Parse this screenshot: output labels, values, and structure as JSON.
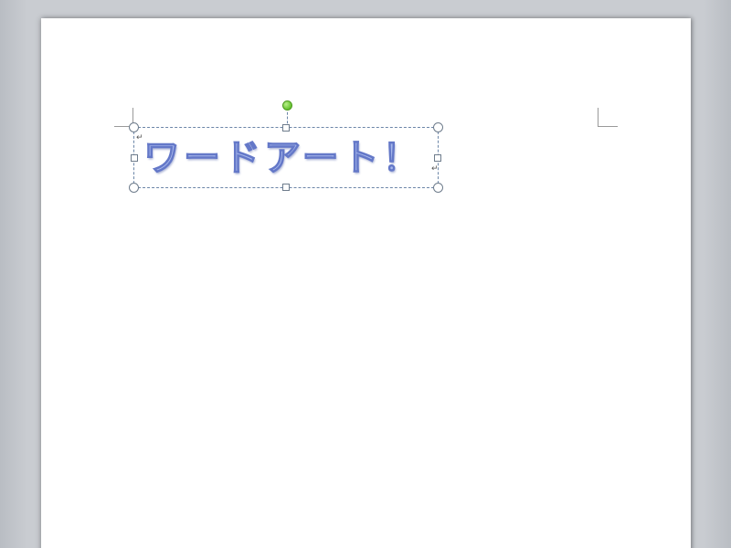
{
  "document": {
    "wordart": {
      "text": "ワードアート！",
      "fill_color": "#a7b8ec",
      "outline_color": "#6478c8",
      "selected": true
    },
    "selection": {
      "rotate_handle_color": "#63c22c",
      "border_color": "#6c86a8",
      "handle_icon": "resize-handle-icon"
    },
    "paragraph_marks": {
      "start": "↵",
      "end": "↵"
    }
  }
}
